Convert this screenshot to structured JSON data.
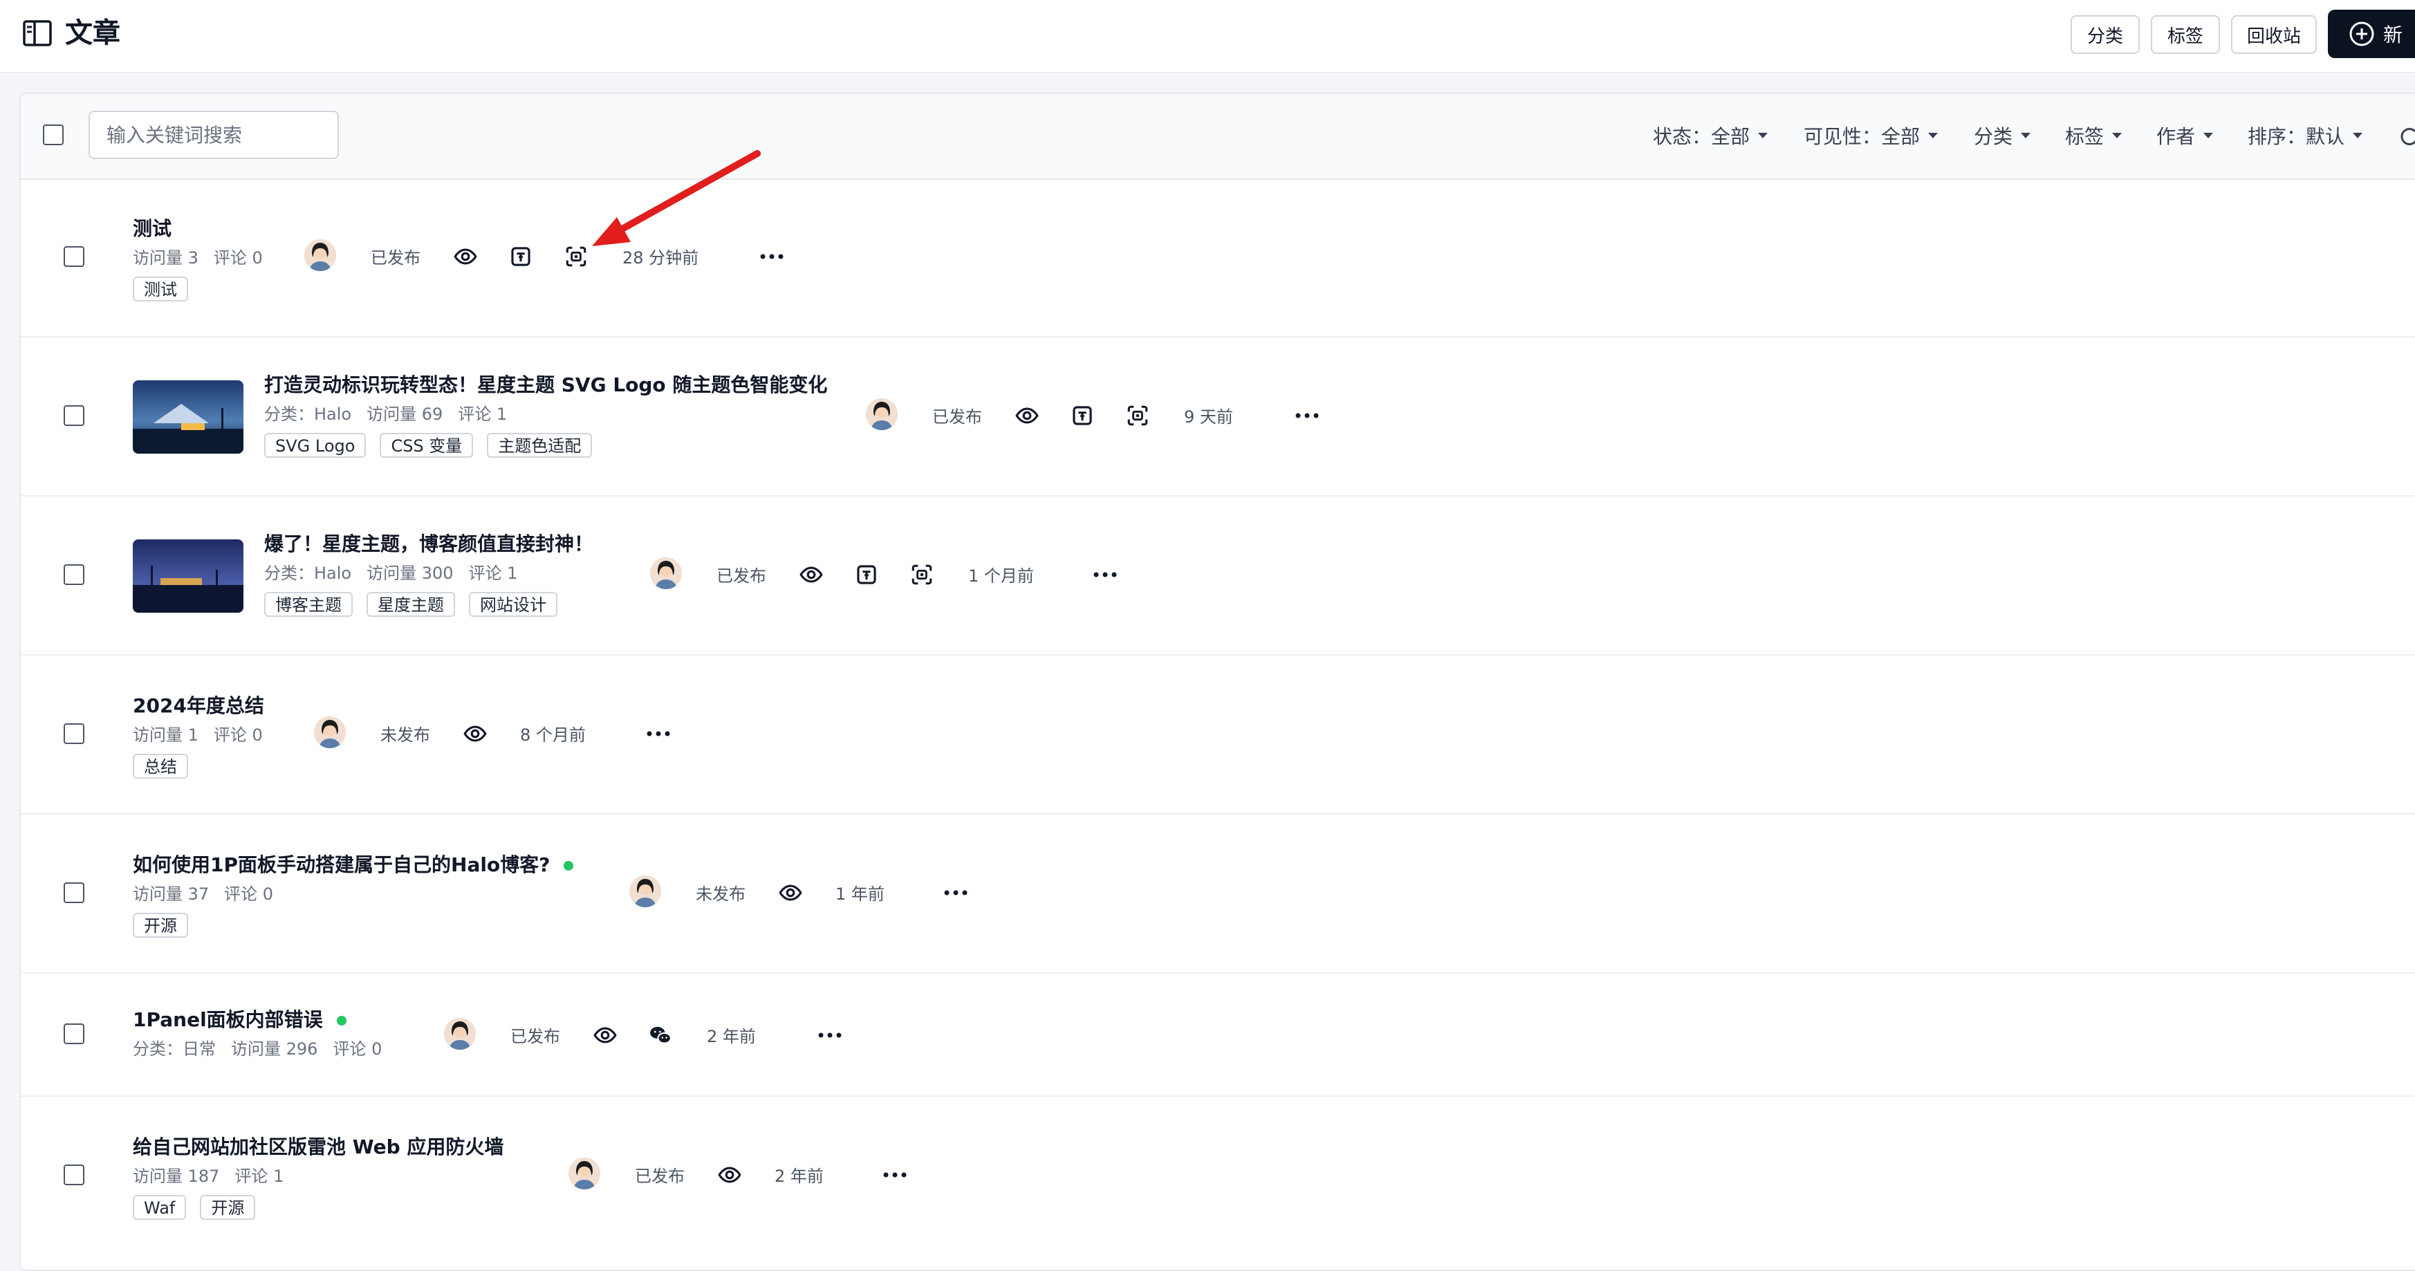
{
  "header": {
    "title": "文章",
    "buttons": {
      "category": "分类",
      "tag": "标签",
      "recycle": "回收站",
      "new": "新"
    }
  },
  "toolbar": {
    "search_placeholder": "输入关键词搜索",
    "filters": {
      "status": "状态：全部",
      "visibility": "可见性：全部",
      "category": "分类",
      "tag": "标签",
      "author": "作者",
      "sort": "排序：默认"
    }
  },
  "posts": [
    {
      "title": "测试",
      "visits": "访问量 3",
      "comments": "评论 0",
      "tags": [
        "测试"
      ],
      "status": "已发布",
      "time": "28 分钟前"
    },
    {
      "title": "打造灵动标识玩转型态！星度主题 SVG Logo 随主题色智能变化",
      "category_label": "分类：",
      "category": "Halo",
      "visits": "访问量 69",
      "comments": "评论 1",
      "tags": [
        "SVG Logo",
        "CSS 变量",
        "主题色适配"
      ],
      "status": "已发布",
      "time": "9 天前"
    },
    {
      "title": "爆了！星度主题，博客颜值直接封神！",
      "category_label": "分类：",
      "category": "Halo",
      "visits": "访问量 300",
      "comments": "评论 1",
      "tags": [
        "博客主题",
        "星度主题",
        "网站设计"
      ],
      "status": "已发布",
      "time": "1 个月前"
    },
    {
      "title": "2024年度总结",
      "visits": "访问量 1",
      "comments": "评论 0",
      "tags": [
        "总结"
      ],
      "status": "未发布",
      "time": "8 个月前"
    },
    {
      "title": "如何使用1P面板手动搭建属于自己的Halo博客?",
      "visits": "访问量 37",
      "comments": "评论 0",
      "tags": [
        "开源"
      ],
      "status": "未发布",
      "time": "1 年前"
    },
    {
      "title": "1Panel面板内部错误",
      "category_label": "分类：",
      "category": "日常",
      "visits": "访问量 296",
      "comments": "评论 0",
      "tags": [],
      "status": "已发布",
      "time": "2 年前"
    },
    {
      "title": "给自己网站加社区版雷池 Web 应用防火墙",
      "visits": "访问量 187",
      "comments": "评论 1",
      "tags": [
        "Waf",
        "开源"
      ],
      "status": "已发布",
      "time": "2 年前"
    }
  ],
  "colors": {
    "primary": "#0b1220",
    "published_dot": "#22c55e",
    "annotation_arrow": "#e11d1d"
  }
}
